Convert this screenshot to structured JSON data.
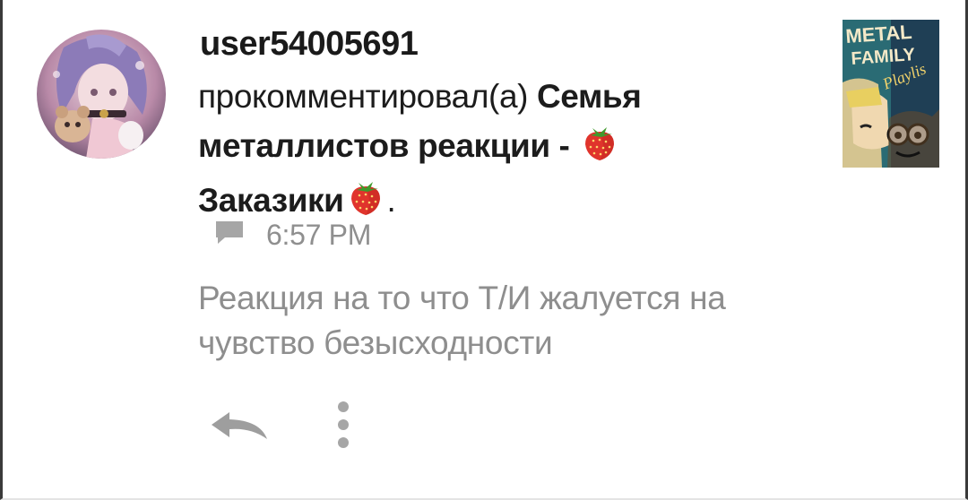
{
  "notification": {
    "username": "user54005691",
    "action_text": "прокомментировал(а)",
    "post_title_part1": "Семья металлистов реакции - ",
    "post_title_part2": "Заказики",
    "trailing_punct": ".",
    "title_emoji": "strawberry-icon",
    "thumbnail_text": {
      "line1": "METAL",
      "line2": "FAMILY",
      "line3": "Playlis"
    },
    "comment_icon": "chat-bubble-icon",
    "time": "6:57 PM",
    "comment_text": "Реакция на то что Т/И жалуется на чувство безысходности"
  },
  "actions": {
    "reply_icon": "reply-arrow-icon",
    "more_icon": "more-vertical-icon"
  },
  "colors": {
    "username": "#1a1a1a",
    "body_text": "#1c1c1c",
    "muted_text": "#8e8e8e",
    "icon_gray": "#a6a6a6",
    "frame_border": "#3a3a3a"
  }
}
